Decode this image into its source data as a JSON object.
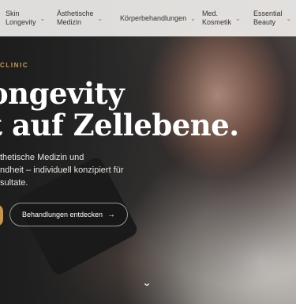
{
  "nav": {
    "items": [
      {
        "label": "Skin\nLongevity"
      },
      {
        "label": "Ästhetische\nMedizin"
      },
      {
        "label": "Körperbehandlungen"
      },
      {
        "label": "Med.\nKosmetik"
      },
      {
        "label": "Essential\nBeauty"
      }
    ],
    "chevron": "⌄"
  },
  "hero": {
    "eyebrow": "CLINIC",
    "headline_line1": "ongevity",
    "headline_line2": "t auf Zellebene.",
    "subtext_line1": "thetische Medizin und",
    "subtext_line2": "ndheit – individuell konzipiert für",
    "subtext_line3": "sultate.",
    "cta_label": "Behandlungen entdecken",
    "cta_arrow": "→",
    "scroll_indicator": "⌄"
  },
  "colors": {
    "accent_gold": "#c6954f",
    "nav_background": "#eeece9"
  }
}
